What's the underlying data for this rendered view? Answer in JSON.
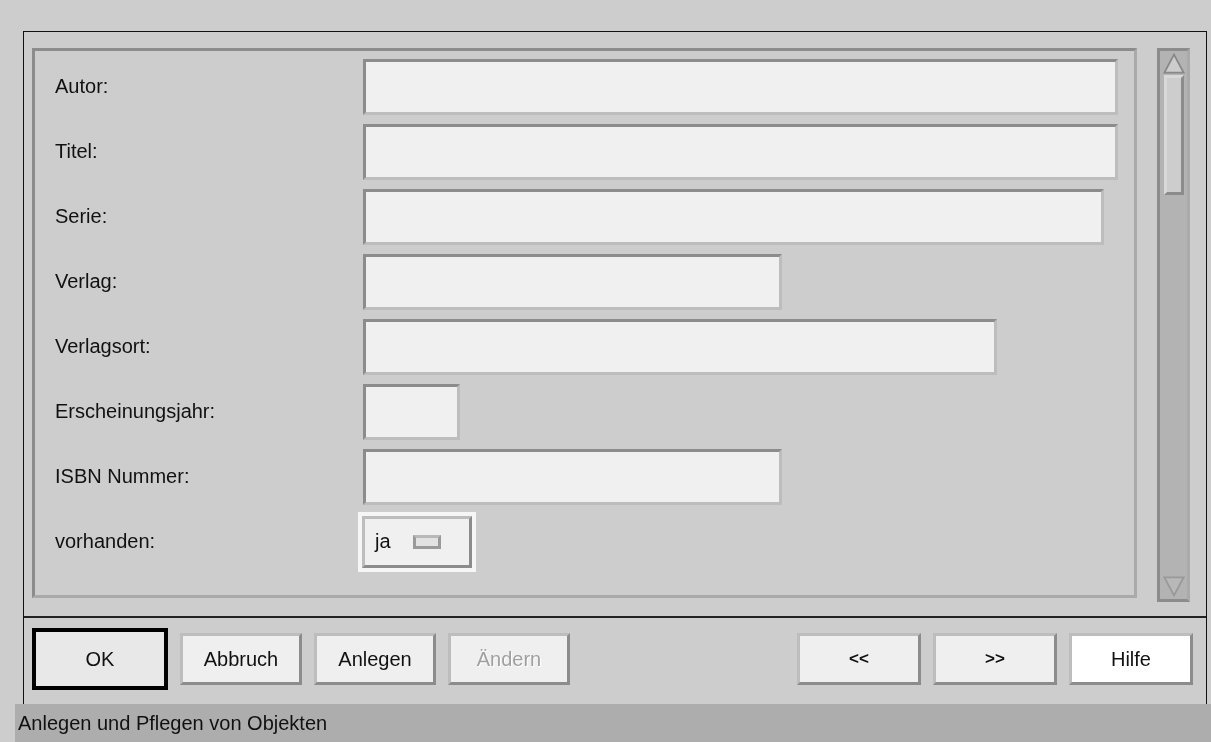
{
  "form": {
    "fields": [
      {
        "label": "Autor:",
        "kind": "text"
      },
      {
        "label": "Titel:",
        "kind": "text"
      },
      {
        "label": "Serie:",
        "kind": "text"
      },
      {
        "label": "Verlag:",
        "kind": "text"
      },
      {
        "label": "Verlagsort:",
        "kind": "text"
      },
      {
        "label": "Erscheinungsjahr:",
        "kind": "text"
      },
      {
        "label": "ISBN Nummer:",
        "kind": "text"
      },
      {
        "label": "vorhanden:",
        "kind": "option",
        "value": "ja"
      }
    ]
  },
  "buttons": [
    {
      "label": "OK",
      "focused": true,
      "disabled": false,
      "highlighted": false
    },
    {
      "label": "Abbruch",
      "focused": false,
      "disabled": false,
      "highlighted": false
    },
    {
      "label": "Anlegen",
      "focused": false,
      "disabled": false,
      "highlighted": false
    },
    {
      "label": "Ändern",
      "focused": false,
      "disabled": true,
      "highlighted": false
    }
  ],
  "nav_buttons": [
    {
      "label": "<<",
      "focused": false,
      "disabled": false,
      "highlighted": false
    },
    {
      "label": ">>",
      "focused": false,
      "disabled": false,
      "highlighted": false
    },
    {
      "label": "Hilfe",
      "focused": false,
      "disabled": false,
      "highlighted": true
    }
  ],
  "status_bar": "Anlegen und Pflegen von Objekten"
}
